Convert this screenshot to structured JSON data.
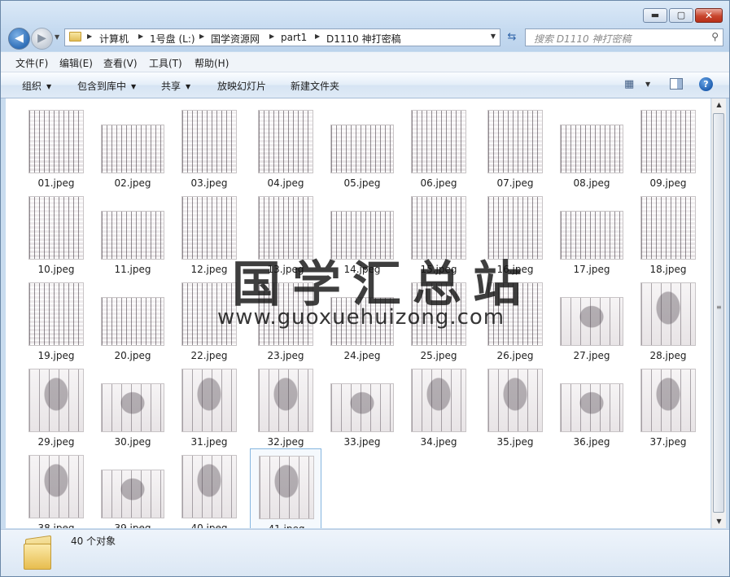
{
  "window": {
    "controls": {
      "minimize": "▬",
      "maximize": "▢",
      "close": "✕"
    }
  },
  "nav": {
    "back": "◀",
    "forward": "▶",
    "recent": "▼"
  },
  "address": {
    "crumbs": [
      "计算机",
      "1号盘 (L:)",
      "国学资源网",
      "part1",
      "D1110 神打密稿"
    ],
    "separator": "▶",
    "dropdown": "▼"
  },
  "search": {
    "placeholder": "搜索 D1110 神打密稿",
    "icon": "⚲",
    "refresh": "⇆"
  },
  "menu": [
    "文件(F)",
    "编辑(E)",
    "查看(V)",
    "工具(T)",
    "帮助(H)"
  ],
  "commands": {
    "organize": "组织",
    "include_in_library": "包含到库中",
    "share": "共享",
    "slideshow": "放映幻灯片",
    "new_folder": "新建文件夹",
    "caret": "▼",
    "views_icon": "▦",
    "help": "?"
  },
  "files": [
    "01.jpeg",
    "02.jpeg",
    "03.jpeg",
    "04.jpeg",
    "05.jpeg",
    "06.jpeg",
    "07.jpeg",
    "08.jpeg",
    "09.jpeg",
    "10.jpeg",
    "11.jpeg",
    "12.jpeg",
    "13.jpeg",
    "14.jpeg",
    "15.jpeg",
    "16.jpeg",
    "17.jpeg",
    "18.jpeg",
    "19.jpeg",
    "20.jpeg",
    "22.jpeg",
    "23.jpeg",
    "24.jpeg",
    "25.jpeg",
    "26.jpeg",
    "27.jpeg",
    "28.jpeg",
    "29.jpeg",
    "30.jpeg",
    "31.jpeg",
    "32.jpeg",
    "33.jpeg",
    "34.jpeg",
    "35.jpeg",
    "36.jpeg",
    "37.jpeg",
    "38.jpeg",
    "39.jpeg",
    "40.jpeg",
    "41.jpeg"
  ],
  "selected_file": "41.jpeg",
  "watermark": {
    "line1": "国学汇总站",
    "line2": "www.guoxuehuizong.com"
  },
  "scrollbar": {
    "up": "▲",
    "down": "▼",
    "grip": "≡"
  },
  "details": {
    "count": "40 个对象"
  }
}
